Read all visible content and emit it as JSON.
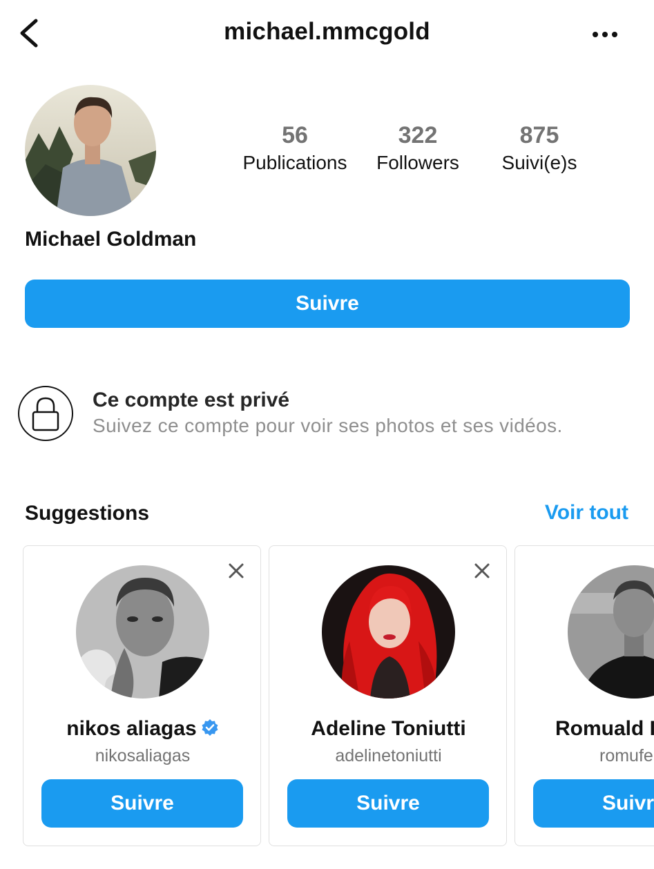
{
  "header": {
    "username": "michael.mmcgold"
  },
  "profile": {
    "full_name": "Michael Goldman",
    "stats": [
      {
        "value": "56",
        "label": "Publications"
      },
      {
        "value": "322",
        "label": "Followers"
      },
      {
        "value": "875",
        "label": "Suivi(e)s"
      }
    ],
    "follow_label": "Suivre"
  },
  "private": {
    "title": "Ce compte est privé",
    "description": "Suivez ce compte pour voir ses photos et ses vidéos."
  },
  "suggestions": {
    "title": "Suggestions",
    "see_all": "Voir tout",
    "cards": [
      {
        "name": "nikos aliagas",
        "handle": "nikosaliagas",
        "verified": true,
        "button": "Suivre"
      },
      {
        "name": "Adeline Toniutti",
        "handle": "adelinetoniutti",
        "verified": false,
        "button": "Suivre"
      },
      {
        "name": "Romuald I",
        "handle": "romufe",
        "verified": false,
        "button": "Suivr"
      }
    ]
  },
  "colors": {
    "accent": "#1a9bf0",
    "muted": "#8e8e8e",
    "verified_badge": "#3897f0"
  },
  "icons": [
    "back-chevron-icon",
    "more-dots-icon",
    "lock-icon",
    "close-icon",
    "verified-badge-icon"
  ]
}
